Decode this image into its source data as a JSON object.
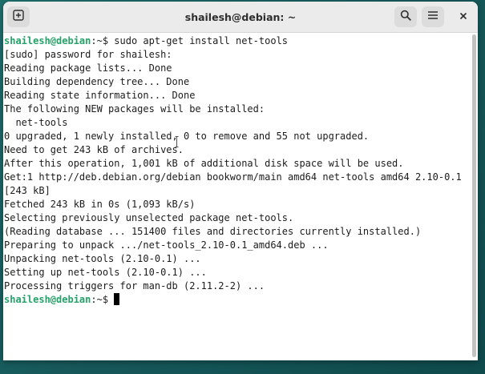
{
  "window": {
    "title": "shailesh@debian: ~"
  },
  "titlebar": {
    "new_tab_icon": "new-tab-icon",
    "search_icon": "search-icon",
    "menu_icon": "hamburger-menu-icon",
    "close_label": "×"
  },
  "terminal": {
    "prompt_user": "shailesh@debian",
    "prompt_path": ":~$ ",
    "command": "sudo apt-get install net-tools",
    "output": [
      "[sudo] password for shailesh:",
      "Reading package lists... Done",
      "Building dependency tree... Done",
      "Reading state information... Done",
      "The following NEW packages will be installed:",
      "  net-tools",
      "0 upgraded, 1 newly installed, 0 to remove and 55 not upgraded.",
      "Need to get 243 kB of archives.",
      "After this operation, 1,001 kB of additional disk space will be used.",
      "Get:1 http://deb.debian.org/debian bookworm/main amd64 net-tools amd64 2.10-0.1",
      "[243 kB]",
      "Fetched 243 kB in 0s (1,093 kB/s)",
      "Selecting previously unselected package net-tools.",
      "(Reading database ... 151400 files and directories currently installed.)",
      "Preparing to unpack .../net-tools_2.10-0.1_amd64.deb ...",
      "Unpacking net-tools (2.10-0.1) ...",
      "Setting up net-tools (2.10-0.1) ...",
      "Processing triggers for man-db (2.11.2-2) ..."
    ]
  },
  "colors": {
    "prompt_green": "#26a269",
    "titlebar_bg": "#ebebeb",
    "terminal_bg": "#ffffff",
    "desktop_teal": "#1f6f6d"
  }
}
